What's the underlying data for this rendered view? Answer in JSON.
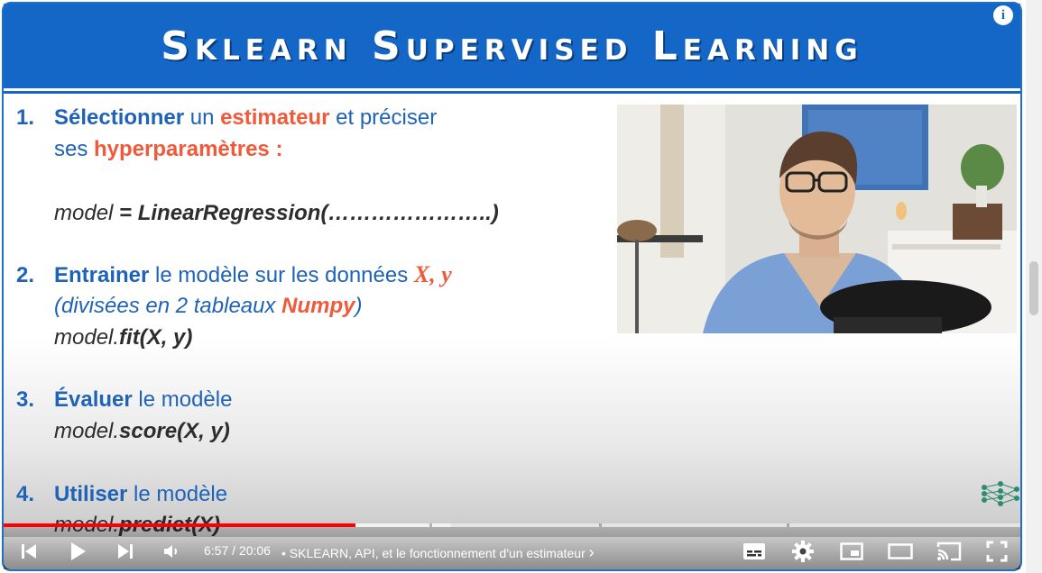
{
  "player": {
    "slide_title": "Sklearn Supervised Learning",
    "info_label": "i",
    "time_current": "6:57",
    "time_separator": " / ",
    "time_total": "20:06",
    "chapter_bullet": "•",
    "chapter_title": "SKLEARN, API, et le fonctionnement d'un estimateur",
    "chapter_chevron": "›",
    "progress_fraction": 0.346,
    "loaded_fraction": 0.44
  },
  "slide": {
    "step1": {
      "num": "1.",
      "w1": "Sélectionner",
      "w2": " un ",
      "w3": "estimateur",
      "w4": " et préciser",
      "line2_a": "ses ",
      "line2_b": "hyperparamètres :",
      "code_a": "model ",
      "code_b": "= LinearRegression(…………………..)"
    },
    "step2": {
      "num": "2.",
      "w1": "Entrainer",
      "w2": " le modèle sur les données ",
      "w3": "X, y",
      "line2_a": "(",
      "line2_b": "divisées  en 2 tableaux ",
      "line2_c": "Numpy",
      "line2_d": ")",
      "code_a": "model.",
      "code_b": "fit(X, y)"
    },
    "step3": {
      "num": "3.",
      "w1": "Évaluer",
      "w2": " le modèle",
      "code_a": "model.",
      "code_b": "score(X, y)"
    },
    "step4": {
      "num": "4.",
      "w1": "Utiliser",
      "w2": " le modèle",
      "code_a": "model.",
      "code_b": "predict(X)"
    }
  },
  "colors": {
    "title_blue": "#1467c7",
    "text_blue": "#1f63b8",
    "accent_red": "#f05a3a",
    "progress_red": "#ff0000"
  },
  "icons": [
    "info-icon",
    "previous-icon",
    "play-icon",
    "next-icon",
    "volume-icon",
    "subtitles-icon",
    "settings-icon",
    "miniplayer-icon",
    "theater-icon",
    "cast-icon",
    "fullscreen-icon",
    "network-logo-icon"
  ]
}
